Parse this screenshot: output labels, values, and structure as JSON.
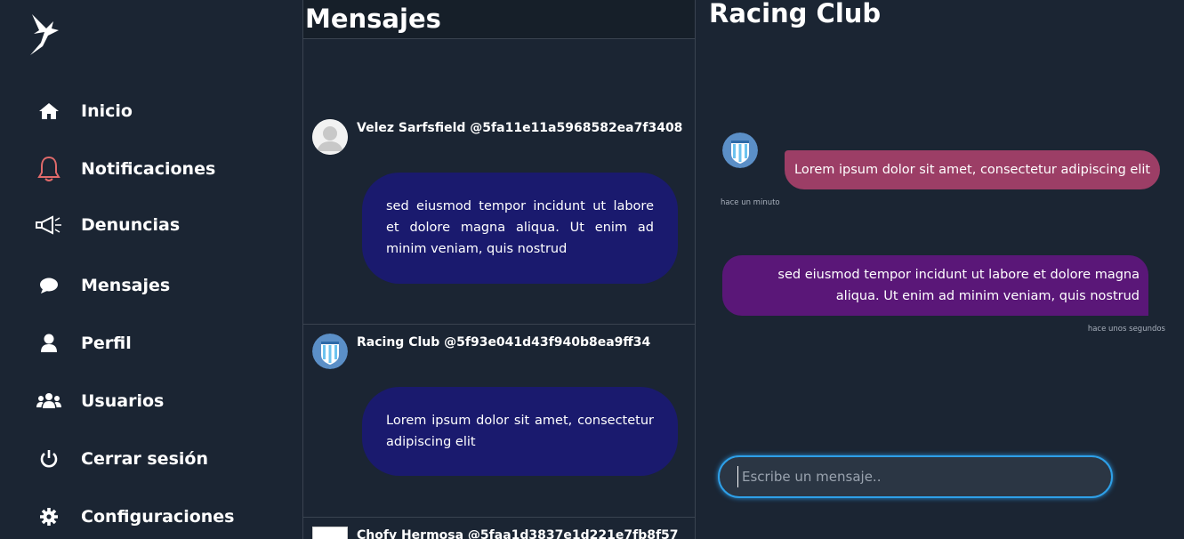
{
  "sidebar": {
    "items": [
      {
        "label": "Inicio",
        "icon": "home-icon"
      },
      {
        "label": "Notificaciones",
        "icon": "bell-icon"
      },
      {
        "label": "Denuncias",
        "icon": "megaphone-icon"
      },
      {
        "label": "Mensajes",
        "icon": "chat-bubble-icon"
      },
      {
        "label": "Perfil",
        "icon": "user-icon"
      },
      {
        "label": "Usuarios",
        "icon": "users-icon"
      },
      {
        "label": "Cerrar sesión",
        "icon": "power-icon"
      },
      {
        "label": "Configuraciones",
        "icon": "gear-icon"
      }
    ]
  },
  "messages": {
    "title": "Mensajes",
    "conversations": [
      {
        "name": "Velez Sarfsfield @5fa11e11a5968582ea7f3408",
        "text": "sed eiusmod tempor incidunt ut labore et dolore magna aliqua. Ut enim ad minim veniam, quis nostrud"
      },
      {
        "name": "Racing Club @5f93e041d43f940b8ea9ff34",
        "text": "Lorem ipsum dolor sit amet, consectetur adipiscing elit"
      },
      {
        "name": "Chofy Hermosa @5faa1d3837e1d221e7fb8f57",
        "text": ""
      }
    ]
  },
  "chat": {
    "title": "Racing Club",
    "incoming": {
      "text": "Lorem ipsum dolor sit amet, consectetur adipiscing elit",
      "time": "hace un minuto"
    },
    "outgoing": {
      "text": "sed eiusmod tempor incidunt ut labore et dolore magna aliqua. Ut enim ad minim veniam, quis nostrud",
      "time": "hace unos segundos"
    },
    "input_placeholder": "Escribe un mensaje.."
  },
  "colors": {
    "background": "#1b2533",
    "bubble_list": "#1a1a6e",
    "bubble_incoming": "#9c3e66",
    "bubble_outgoing": "#5a1778",
    "bell_accent": "#e06a6a",
    "input_border": "#2ea0e8"
  }
}
